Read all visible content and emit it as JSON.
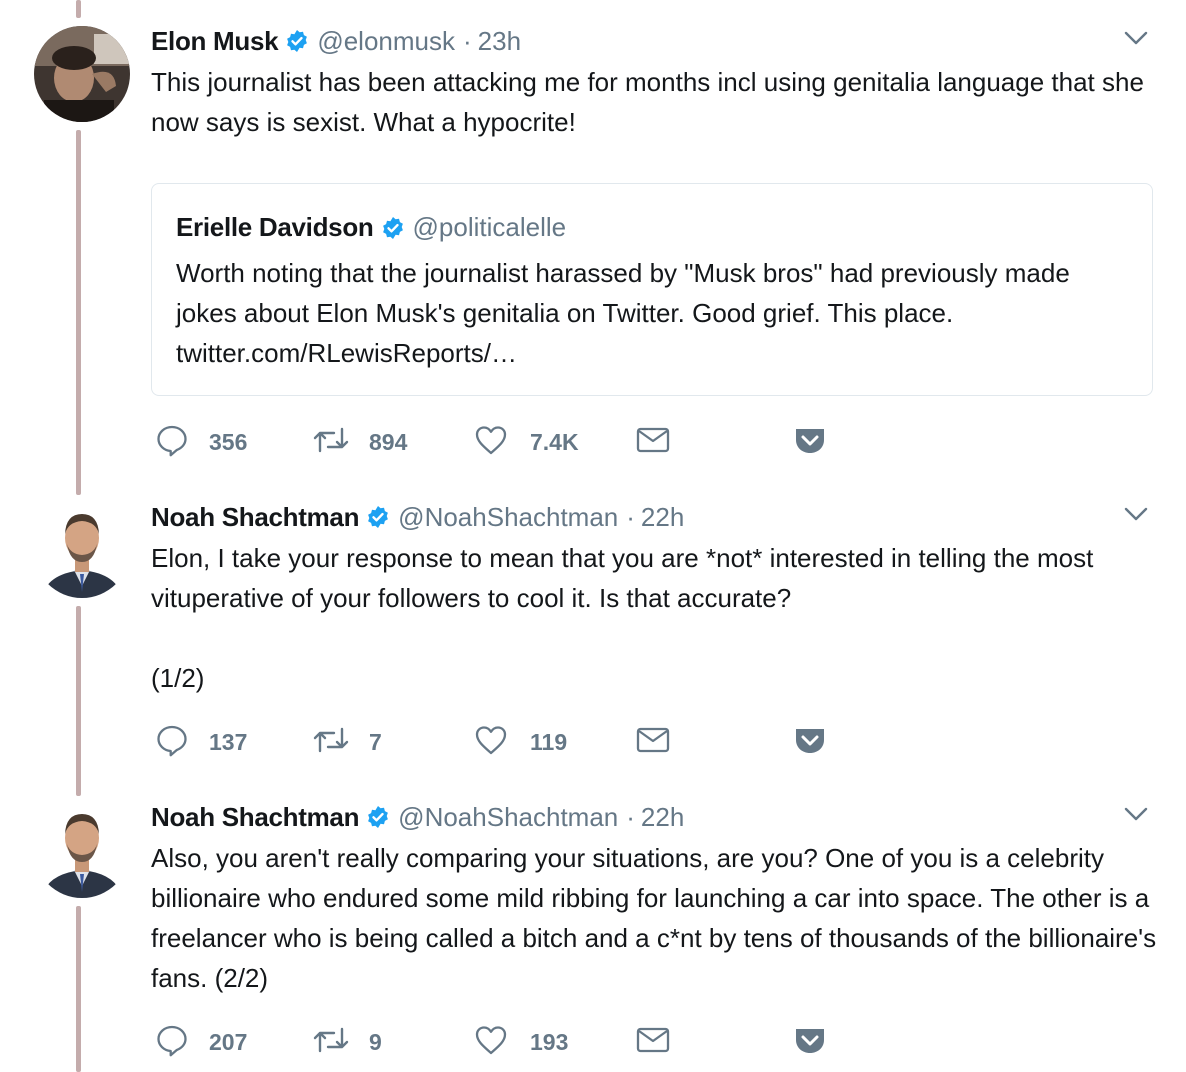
{
  "colors": {
    "verified": "#1da1f2",
    "icon": "#657786",
    "thread_line": "#c4acac"
  },
  "tweets": [
    {
      "name": "Elon Musk",
      "handle": "@elonmusk",
      "time": "23h",
      "text": "This journalist has been attacking me for months incl using genitalia language that she now says is sexist. What a hypocrite!",
      "quote": {
        "name": "Erielle Davidson",
        "handle": "@politicalelle",
        "text": "Worth noting that the journalist harassed by \"Musk bros\" had previously made jokes about Elon Musk's genitalia on Twitter. Good grief. This place. twitter.com/RLewisReports/…"
      },
      "replies": "356",
      "retweets": "894",
      "likes": "7.4K"
    },
    {
      "name": "Noah Shachtman",
      "handle": "@NoahShachtman",
      "time": "22h",
      "text": "Elon, I take your response to mean that you are *not* interested in telling the most vituperative of your followers to cool it. Is that accurate?\n\n(1/2)",
      "replies": "137",
      "retweets": "7",
      "likes": "119"
    },
    {
      "name": "Noah Shachtman",
      "handle": "@NoahShachtman",
      "time": "22h",
      "text": "Also, you aren't really comparing your situations, are you? One of you is a celebrity billionaire who endured some mild ribbing for launching a car into space. The other is a freelancer who is being called a bitch and a c*nt by tens of thousands of the billionaire's fans. (2/2)",
      "replies": "207",
      "retweets": "9",
      "likes": "193"
    }
  ]
}
